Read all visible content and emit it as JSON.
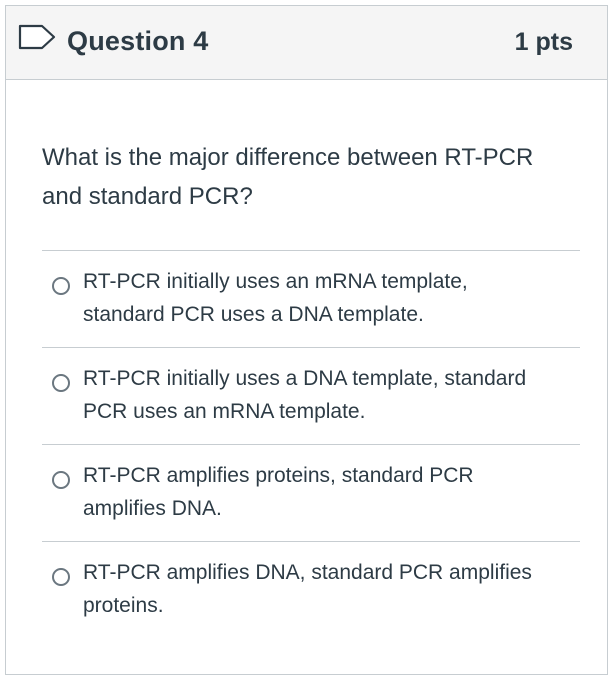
{
  "question": {
    "title": "Question 4",
    "points": "1 pts",
    "text": "What is the major difference between RT-PCR and standard PCR?",
    "answers": [
      {
        "label": "RT-PCR initially uses an mRNA template, standard PCR uses a DNA template."
      },
      {
        "label": "RT-PCR initially uses a DNA template, standard PCR uses an mRNA template."
      },
      {
        "label": "RT-PCR amplifies proteins, standard PCR amplifies DNA."
      },
      {
        "label": "RT-PCR amplifies DNA, standard PCR amplifies proteins."
      }
    ]
  },
  "colors": {
    "text": "#2d3b45",
    "header_background": "#f5f5f5",
    "border": "#c7cdd1"
  },
  "icons": {
    "flag": "flag-question-icon",
    "radio": "radio-unselected-icon"
  }
}
